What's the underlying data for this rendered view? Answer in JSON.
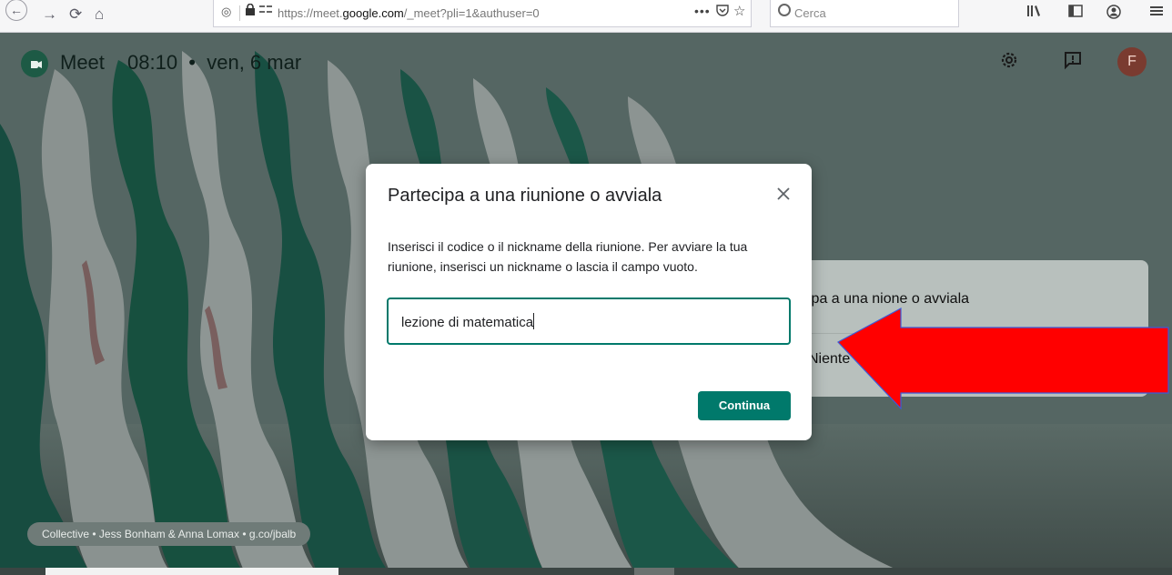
{
  "browser": {
    "nav_back": "←",
    "nav_forward": "→",
    "nav_reload": "⟳",
    "nav_home": "⌂",
    "url_prefix": "https://meet.",
    "url_domain": "google.com",
    "url_suffix": "/_meet?pli=1&authuser=0",
    "url_more": "•••",
    "search_placeholder": "Cerca",
    "toolbar_icons": [
      "library-icon",
      "sidebar-icon",
      "account-icon",
      "menu-icon"
    ]
  },
  "header": {
    "app_name": "Meet",
    "time": "08:10",
    "separator": "•",
    "date": "ven, 6 mar",
    "avatar_initial": "F",
    "icons": [
      "settings-icon",
      "feedback-icon"
    ]
  },
  "side_card": {
    "row1_text": "ipa a una    nione o avviala",
    "row2_text": "Niente"
  },
  "dialog": {
    "title": "Partecipa a una riunione o avviala",
    "description": "Inserisci il codice o il nickname della riunione. Per avviare la tua riunione, inserisci un nickname o lascia il campo vuoto.",
    "input_value": "lezione di matematica",
    "continue_label": "Continua"
  },
  "credit": {
    "text": "Collective • Jess Bonham & Anna Lomax • g.co/jbalb"
  },
  "colors": {
    "accent": "#00796b",
    "arrow": "#ff0000",
    "avatar_bg": "#7a3b30"
  }
}
